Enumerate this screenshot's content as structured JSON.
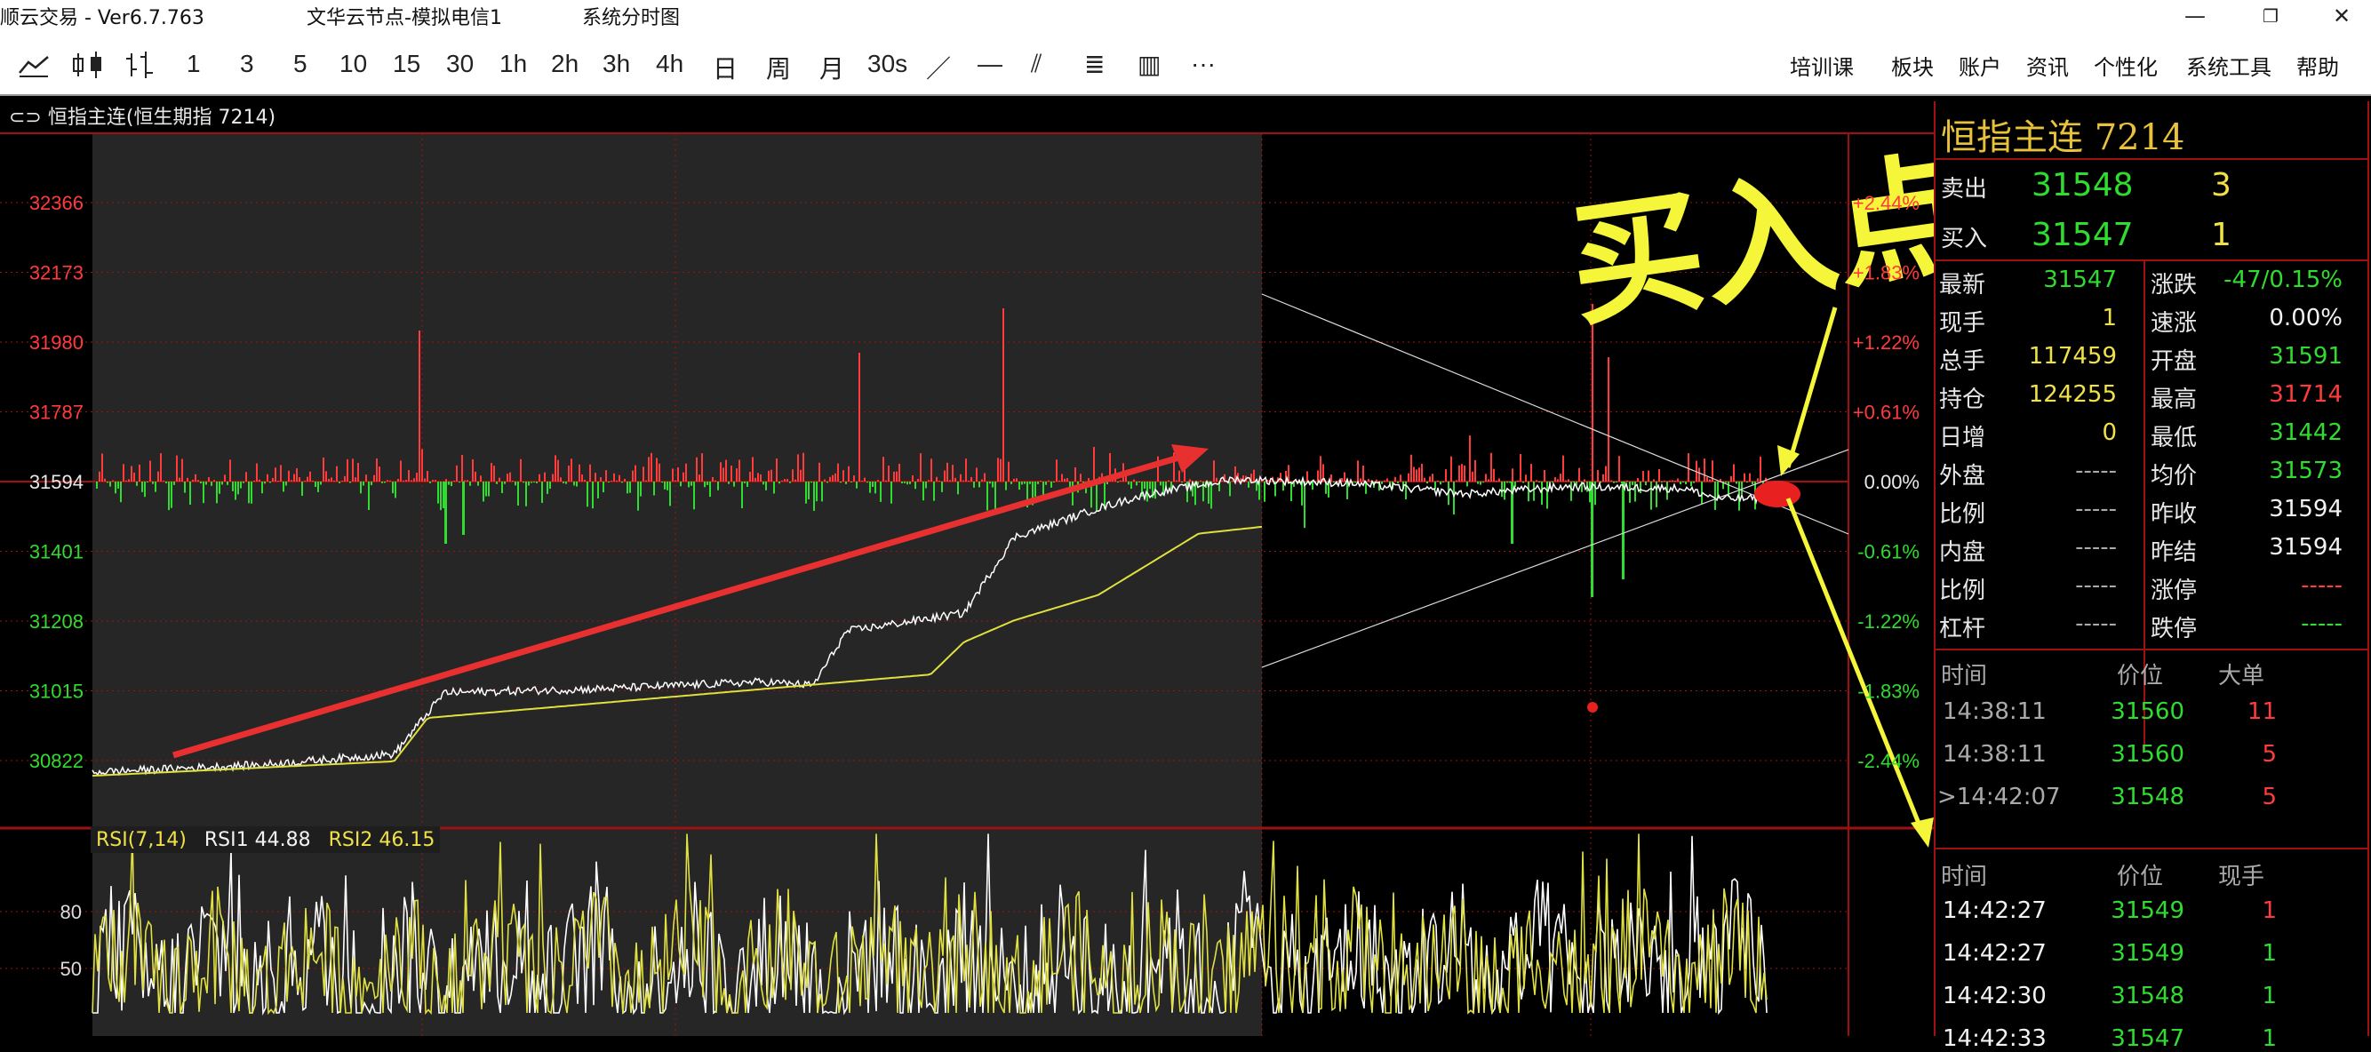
{
  "titlebar": {
    "app": "顺云交易  -  Ver6.7.763",
    "node": "文华云节点-模拟电信1",
    "mode": "系统分时图",
    "minimize": "—",
    "maximize": "❐",
    "close": "✕"
  },
  "toolbar": {
    "icons": [
      "line-chart-icon",
      "candlestick-icon",
      "bar-style-icon"
    ],
    "periods": [
      "1",
      "3",
      "5",
      "10",
      "15",
      "30",
      "1h",
      "2h",
      "3h",
      "4h",
      "日",
      "周",
      "月",
      "30s"
    ],
    "draw_tools": [
      "／",
      "—",
      "⫽",
      "≣",
      "▥",
      "···"
    ],
    "menus": [
      "培训课",
      "板块",
      "账户",
      "资讯",
      "个性化",
      "系统工具",
      "帮助"
    ]
  },
  "chart_header": {
    "link_icon": "⊂⊃",
    "text": "恒指主连(恒生期指 7214)"
  },
  "annotation": {
    "text": "买入点"
  },
  "chart_data": {
    "type": "line",
    "instrument": "恒指主连",
    "y_ticks": [
      "32366",
      "32173",
      "31980",
      "31787",
      "31594",
      "31401",
      "31208",
      "31015",
      "30822"
    ],
    "pct_ticks": [
      "+2.44%",
      "+1.83%",
      "+1.22%",
      "+0.61%",
      "0.00%",
      "-0.61%",
      "-1.22%",
      "-1.83%",
      "-2.44%"
    ],
    "ylim": [
      30822,
      32366
    ],
    "prev_settle": 31594,
    "grid": true,
    "series": [
      {
        "name": "",
        "color": "#ffffff"
      },
      {
        "name": "",
        "color": "#e0e040"
      }
    ],
    "price_anchor_points": [
      [
        0,
        30790
      ],
      [
        0.1,
        30810
      ],
      [
        0.18,
        30840
      ],
      [
        0.21,
        31010
      ],
      [
        0.3,
        31020
      ],
      [
        0.4,
        31040
      ],
      [
        0.43,
        31030
      ],
      [
        0.45,
        31180
      ],
      [
        0.52,
        31230
      ],
      [
        0.55,
        31440
      ],
      [
        0.6,
        31520
      ],
      [
        0.63,
        31560
      ],
      [
        0.68,
        31600
      ],
      [
        0.75,
        31590
      ],
      [
        0.82,
        31560
      ],
      [
        0.88,
        31580
      ],
      [
        0.95,
        31575
      ],
      [
        0.97,
        31547
      ]
    ],
    "avg_anchor_points": [
      [
        0,
        30780
      ],
      [
        0.18,
        30820
      ],
      [
        0.2,
        30940
      ],
      [
        0.3,
        30980
      ],
      [
        0.4,
        31020
      ],
      [
        0.5,
        31060
      ],
      [
        0.52,
        31150
      ],
      [
        0.55,
        31210
      ],
      [
        0.6,
        31280
      ],
      [
        0.66,
        31450
      ],
      [
        0.7,
        31470
      ]
    ],
    "rsi": {
      "label": "RSI(7,14)",
      "rsi1_label": "RSI1 44.88",
      "rsi2_label": "RSI2 46.15",
      "ticks": [
        "80",
        "50"
      ],
      "ylim": [
        0,
        100
      ]
    }
  },
  "quote": {
    "title": "恒指主连  7214",
    "sell": {
      "label": "卖出",
      "price": "31548",
      "vol": "3"
    },
    "buy": {
      "label": "买入",
      "price": "31547",
      "vol": "1"
    },
    "rows": [
      {
        "l1": "最新",
        "v1": "31547",
        "c1": "g",
        "l2": "涨跌",
        "v2": "-47/0.15%",
        "c2": "g"
      },
      {
        "l1": "现手",
        "v1": "1",
        "c1": "y",
        "l2": "速涨",
        "v2": "0.00%",
        "c2": "w"
      },
      {
        "l1": "总手",
        "v1": "117459",
        "c1": "y",
        "l2": "开盘",
        "v2": "31591",
        "c2": "g"
      },
      {
        "l1": "持仓",
        "v1": "124255",
        "c1": "y",
        "l2": "最高",
        "v2": "31714",
        "c2": "r"
      },
      {
        "l1": "日增",
        "v1": "0",
        "c1": "y",
        "l2": "最低",
        "v2": "31442",
        "c2": "g"
      },
      {
        "l1": "外盘",
        "v1": "-----",
        "c1": "gr",
        "l2": "均价",
        "v2": "31573",
        "c2": "g"
      },
      {
        "l1": "比例",
        "v1": "-----",
        "c1": "gr",
        "l2": "昨收",
        "v2": "31594",
        "c2": "w"
      },
      {
        "l1": "内盘",
        "v1": "-----",
        "c1": "gr",
        "l2": "昨结",
        "v2": "31594",
        "c2": "w"
      },
      {
        "l1": "比例",
        "v1": "-----",
        "c1": "gr",
        "l2": "涨停",
        "v2": "-----",
        "c2": "r"
      },
      {
        "l1": "杠杆",
        "v1": "-----",
        "c1": "gr",
        "l2": "跌停",
        "v2": "-----",
        "c2": "g"
      }
    ],
    "big_orders": {
      "headers": [
        "时间",
        "价位",
        "大单"
      ],
      "rows": [
        [
          "14:38:11",
          "31560",
          "11"
        ],
        [
          "14:38:11",
          "31560",
          "5"
        ],
        [
          "14:42:07",
          "31548",
          "5"
        ]
      ]
    },
    "ticks": {
      "headers": [
        "时间",
        "价位",
        "现手"
      ],
      "rows": [
        [
          "14:42:27",
          "31549",
          "1",
          "r"
        ],
        [
          "14:42:27",
          "31549",
          "1",
          "g"
        ],
        [
          "14:42:30",
          "31548",
          "1",
          "g"
        ],
        [
          "14:42:33",
          "31547",
          "1",
          "g"
        ]
      ]
    }
  },
  "colors": {
    "grid": "#a01010",
    "up": "#ff3b3b",
    "down": "#2fdc2f",
    "price": "#ffffff",
    "avg": "#e0e040",
    "annotation": "#f5f53a",
    "arrow": "#e83030"
  }
}
